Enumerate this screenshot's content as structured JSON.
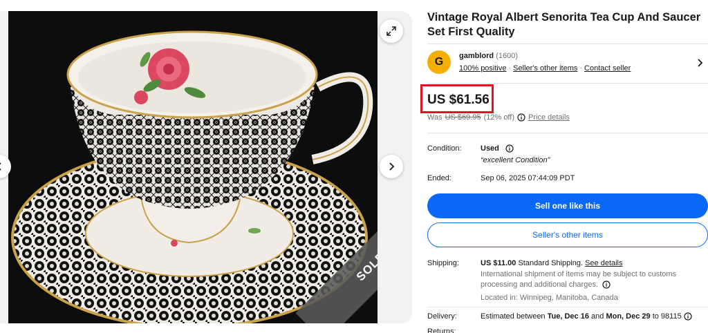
{
  "listing": {
    "title": "Vintage Royal Albert Senorita Tea Cup And Saucer Set First Quality",
    "sold_badge": "SOLD"
  },
  "gallery": {
    "expand_icon": "expand-icon",
    "next_icon": "chevron-right-icon",
    "prev_icon": "chevron-left-icon"
  },
  "seller": {
    "avatar_letter": "G",
    "name": "gamblord",
    "feedback_count": "(1600)",
    "positive": "100% positive",
    "other_items_link": "Seller's other items",
    "contact_link": "Contact seller",
    "avatar_color": "#f5af02"
  },
  "price": {
    "current": "US $61.56",
    "was_label": "Was",
    "was_value": "US $69.95",
    "discount": "(12% off)",
    "details_link": "Price details",
    "highlight_color": "#e0141e"
  },
  "condition": {
    "label": "Condition:",
    "value": "Used",
    "note": "“excellent Condition”"
  },
  "ended": {
    "label": "Ended:",
    "value": "Sep 06, 2025 07:44:09 PDT"
  },
  "buttons": {
    "sell_one": "Sell one like this",
    "other_items": "Seller's other items",
    "primary_color": "#0968f6"
  },
  "shipping": {
    "label": "Shipping:",
    "cost": "US $11.00",
    "method": "Standard Shipping.",
    "details_link": "See details",
    "note": "International shipment of items may be subject to customs processing and additional charges.",
    "location": "Located in: Winnipeg, Manitoba, Canada"
  },
  "delivery": {
    "label": "Delivery:",
    "prefix": "Estimated between",
    "start": "Tue, Dec 16",
    "and": "and",
    "end": "Mon, Dec 29",
    "to": "to 98115"
  },
  "returns": {
    "label": "Returns:"
  }
}
